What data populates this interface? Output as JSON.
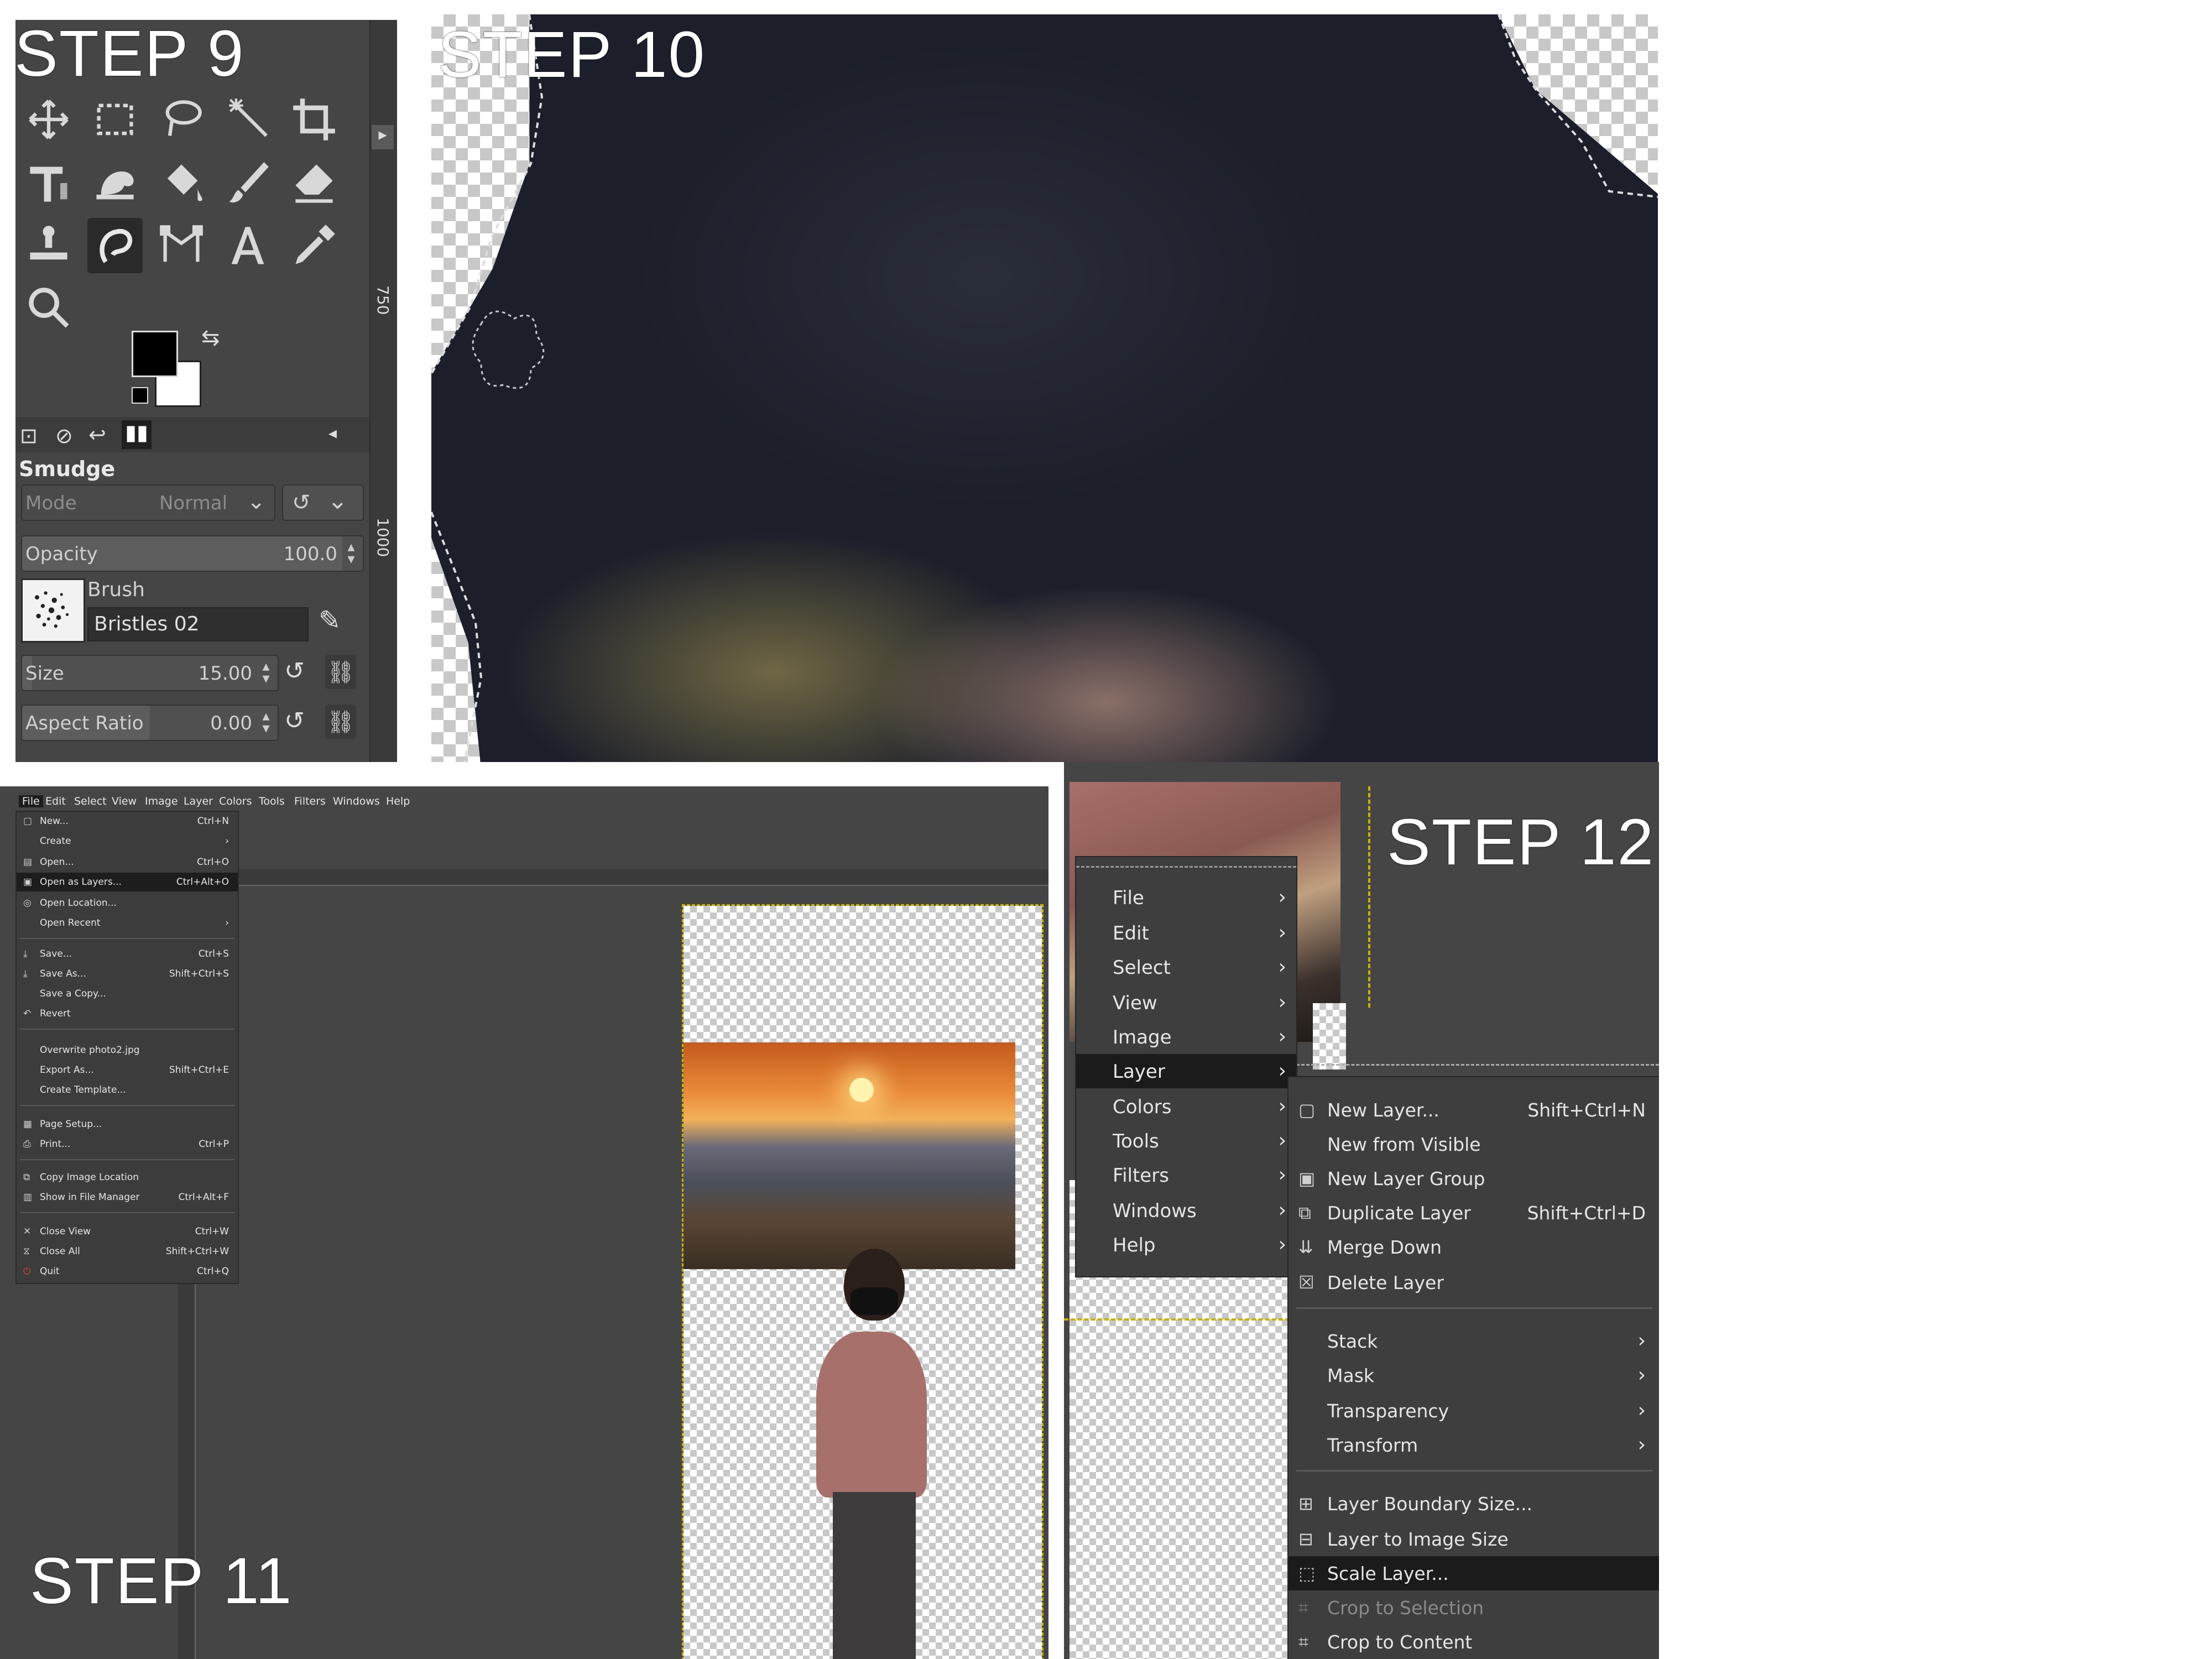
{
  "steps": {
    "s9": "STEP 9",
    "s10": "STEP 10",
    "s11": "STEP 11",
    "s12": "STEP 12"
  },
  "toolbox": {
    "tools": [
      "move-icon",
      "rect-select-icon",
      "lasso-icon",
      "fuzzy-select-icon",
      "crop-icon",
      "unified-transform-icon",
      "warp-icon",
      "bucket-fill-icon",
      "paintbrush-icon",
      "eraser-icon",
      "clone-icon",
      "smudge-icon",
      "paths-icon",
      "text-icon",
      "color-picker-icon",
      "zoom-icon"
    ],
    "active_tool": "smudge-icon",
    "fg_color": "#000000",
    "bg_color": "#ffffff",
    "tool_name": "Smudge",
    "mode_label": "Mode",
    "mode_value": "Normal",
    "opacity_label": "Opacity",
    "opacity_value": "100.0",
    "brush_label": "Brush",
    "brush_name": "Bristles 02",
    "size_label": "Size",
    "size_value": "15.00",
    "aspect_label": "Aspect Ratio",
    "aspect_value": "0.00",
    "ruler_a": "750",
    "ruler_b": "1000"
  },
  "file_menu": {
    "menubar": [
      "File",
      "Edit",
      "Select",
      "View",
      "Image",
      "Layer",
      "Colors",
      "Tools",
      "Filters",
      "Windows",
      "Help"
    ],
    "items": [
      {
        "label": "New...",
        "shortcut": "Ctrl+N",
        "icon": "new-icon"
      },
      {
        "label": "Create",
        "shortcut": ">",
        "icon": ""
      },
      {
        "label": "Open...",
        "shortcut": "Ctrl+O",
        "icon": "open-icon"
      },
      {
        "label": "Open as Layers...",
        "shortcut": "Ctrl+Alt+O",
        "icon": "open-layers-icon"
      },
      {
        "label": "Open Location...",
        "shortcut": "",
        "icon": "location-icon"
      },
      {
        "label": "Open Recent",
        "shortcut": ">",
        "icon": ""
      },
      {
        "label": "Save...",
        "shortcut": "Ctrl+S",
        "icon": "save-icon"
      },
      {
        "label": "Save As...",
        "shortcut": "Shift+Ctrl+S",
        "icon": "save-as-icon"
      },
      {
        "label": "Save a Copy...",
        "shortcut": "",
        "icon": ""
      },
      {
        "label": "Revert",
        "shortcut": "",
        "icon": "revert-icon"
      },
      {
        "label": "Overwrite photo2.jpg",
        "shortcut": "",
        "icon": ""
      },
      {
        "label": "Export As...",
        "shortcut": "Shift+Ctrl+E",
        "icon": ""
      },
      {
        "label": "Create Template...",
        "shortcut": "",
        "icon": ""
      },
      {
        "label": "Page Setup...",
        "shortcut": "",
        "icon": "page-setup-icon"
      },
      {
        "label": "Print...",
        "shortcut": "Ctrl+P",
        "icon": "print-icon"
      },
      {
        "label": "Copy Image Location",
        "shortcut": "",
        "icon": "copy-location-icon"
      },
      {
        "label": "Show in File Manager",
        "shortcut": "Ctrl+Alt+F",
        "icon": "file-manager-icon"
      },
      {
        "label": "Close View",
        "shortcut": "Ctrl+W",
        "icon": "close-icon"
      },
      {
        "label": "Close All",
        "shortcut": "Shift+Ctrl+W",
        "icon": "close-all-icon"
      },
      {
        "label": "Quit",
        "shortcut": "Ctrl+Q",
        "icon": "quit-icon"
      }
    ],
    "highlighted": "Open as Layers..."
  },
  "layer_menu": {
    "main": [
      "File",
      "Edit",
      "Select",
      "View",
      "Image",
      "Layer",
      "Colors",
      "Tools",
      "Filters",
      "Windows",
      "Help"
    ],
    "main_highlighted": "Layer",
    "sub": [
      {
        "label": "New Layer...",
        "shortcut": "Shift+Ctrl+N",
        "icon": "new-layer-icon"
      },
      {
        "label": "New from Visible",
        "shortcut": "",
        "icon": ""
      },
      {
        "label": "New Layer Group",
        "shortcut": "",
        "icon": "layer-group-icon"
      },
      {
        "label": "Duplicate Layer",
        "shortcut": "Shift+Ctrl+D",
        "icon": "duplicate-icon"
      },
      {
        "label": "Merge Down",
        "shortcut": "",
        "icon": "merge-down-icon"
      },
      {
        "label": "Delete Layer",
        "shortcut": "",
        "icon": "delete-icon"
      },
      {
        "label": "Stack",
        "shortcut": "",
        "icon": ""
      },
      {
        "label": "Mask",
        "shortcut": "",
        "icon": ""
      },
      {
        "label": "Transparency",
        "shortcut": "",
        "icon": ""
      },
      {
        "label": "Transform",
        "shortcut": "",
        "icon": ""
      },
      {
        "label": "Layer Boundary Size...",
        "shortcut": "",
        "icon": "boundary-icon"
      },
      {
        "label": "Layer to Image Size",
        "shortcut": "",
        "icon": "to-image-size-icon"
      },
      {
        "label": "Scale Layer...",
        "shortcut": "",
        "icon": "scale-layer-icon"
      },
      {
        "label": "Crop to Selection",
        "shortcut": "",
        "icon": "crop-selection-icon"
      },
      {
        "label": "Crop to Content",
        "shortcut": "",
        "icon": "crop-content-icon"
      }
    ],
    "highlighted": "Scale Layer..."
  },
  "colors": {
    "gimp_bg": "#454545",
    "menu_bg": "#3e3e3e",
    "highlight": "#1b1b1b"
  }
}
